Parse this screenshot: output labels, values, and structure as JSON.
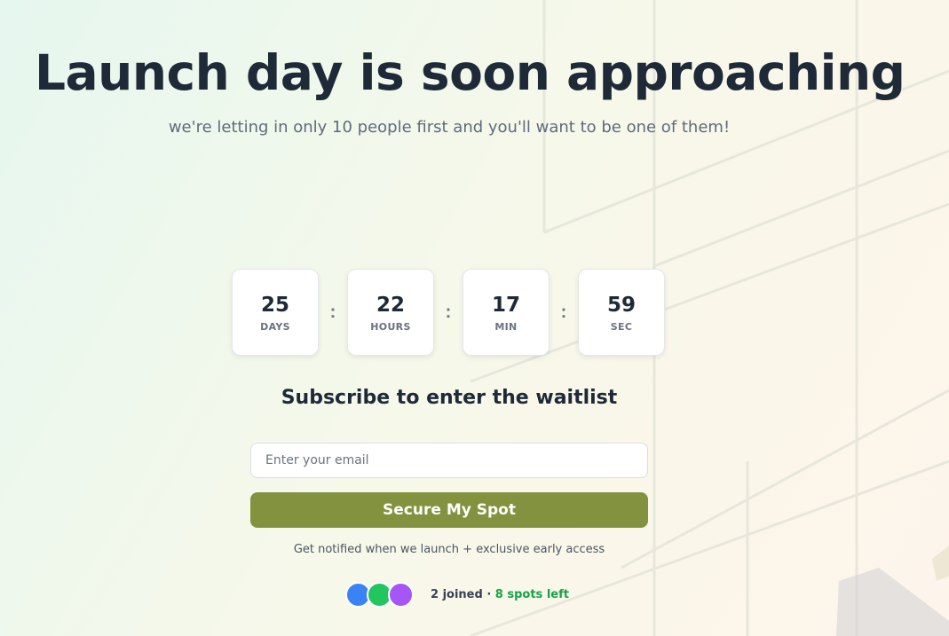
{
  "hero": {
    "title": "Launch day is soon approaching",
    "subtitle": "we're letting in only 10 people first and you'll want to be one of them!"
  },
  "countdown": [
    {
      "value": "25",
      "label": "DAYS"
    },
    {
      "value": "22",
      "label": "HOURS"
    },
    {
      "value": "17",
      "label": "MIN"
    },
    {
      "value": "59",
      "label": "SEC"
    }
  ],
  "countdown_separator": ":",
  "signup": {
    "heading": "Subscribe to enter the waitlist",
    "email_placeholder": "Enter your email",
    "email_value": "",
    "button_label": "Secure My Spot",
    "note": "Get notified when we launch + exclusive early access"
  },
  "social_proof": {
    "joined": "2 joined",
    "separator": " · ",
    "spots_left": "8 spots left",
    "avatars": [
      "#3b82f6",
      "#22c55e",
      "#a855f7"
    ]
  },
  "colors": {
    "accent": "#83923e",
    "spots": "#16a34a",
    "text_dark": "#1e2a38"
  }
}
